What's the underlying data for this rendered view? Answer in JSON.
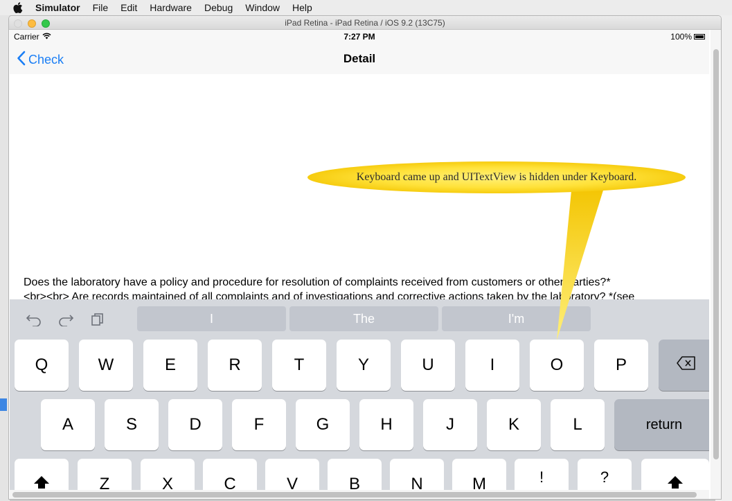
{
  "mac_menu": {
    "apple_icon": "apple-logo-icon",
    "items": [
      "Simulator",
      "File",
      "Edit",
      "Hardware",
      "Debug",
      "Window",
      "Help"
    ]
  },
  "window": {
    "title": "iPad Retina - iPad Retina / iOS 9.2 (13C75)"
  },
  "status_bar": {
    "carrier": "Carrier",
    "time": "7:27 PM",
    "battery": "100%"
  },
  "nav": {
    "back_label": "Check",
    "title": "Detail"
  },
  "content": {
    "question_line1": "Does the laboratory have a policy and procedure for resolution of complaints received from customers or other parties?*",
    "question_line2": "<br><br> Are records maintained of all complaints and of investigations and corrective actions taken by the laboratory? *(see"
  },
  "annotation": {
    "text": "Keyboard came up and UITextView is hidden under Keyboard.",
    "color": "#ffe23a"
  },
  "keyboard": {
    "toolbar": [
      "undo-icon",
      "redo-icon",
      "paste-icon"
    ],
    "suggestions": [
      "I",
      "The",
      "I'm"
    ],
    "row1": [
      "Q",
      "W",
      "E",
      "R",
      "T",
      "Y",
      "U",
      "I",
      "O",
      "P"
    ],
    "row2": [
      "A",
      "S",
      "D",
      "F",
      "G",
      "H",
      "J",
      "K",
      "L"
    ],
    "return_label": "return",
    "row3": [
      "Z",
      "X",
      "C",
      "V",
      "B",
      "N",
      "M"
    ],
    "punct1_top": "!",
    "punct1_bottom": ",",
    "punct2_top": "?",
    "punct2_bottom": "."
  },
  "colors": {
    "ios_blue": "#1a7ef5",
    "keyboard_bg": "#d5d8dd",
    "key_gray": "#b3b8c1"
  }
}
